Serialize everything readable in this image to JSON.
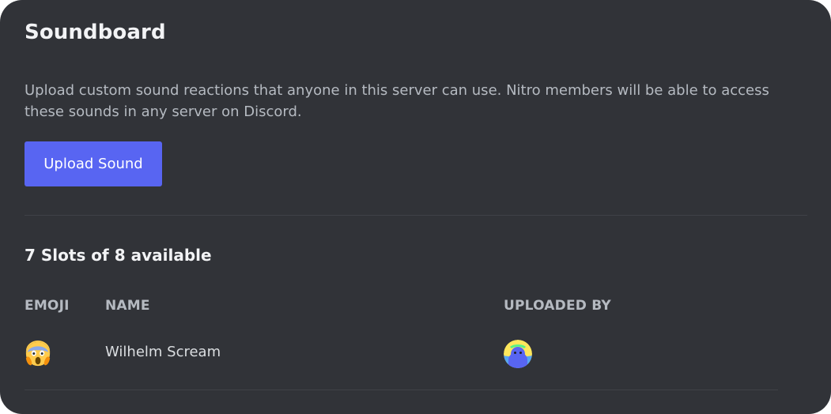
{
  "header": {
    "title": "Soundboard"
  },
  "description": "Upload custom sound reactions that anyone in this server can use. Nitro members will be able to access these sounds in any server on Discord.",
  "upload_button": {
    "label": "Upload Sound"
  },
  "slots_text": "7 Slots of 8 available",
  "table": {
    "columns": [
      "EMOJI",
      "NAME",
      "UPLOADED BY"
    ],
    "rows": [
      {
        "emoji_icon": "face-screaming-in-fear-icon",
        "name": "Wilhelm Scream",
        "uploader_avatar_icon": "avatar-icon"
      }
    ]
  },
  "colors": {
    "background": "#313338",
    "accent": "#5865f2",
    "title_text": "#f2f3f5",
    "muted_text": "#b5bac1",
    "divider": "#3f4147"
  }
}
